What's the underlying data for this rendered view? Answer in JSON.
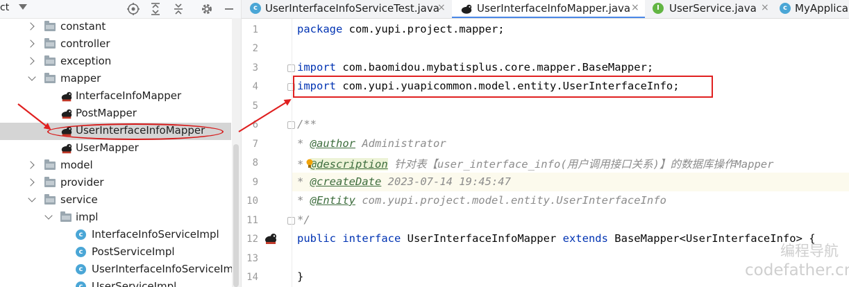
{
  "project_panel": {
    "title": "ct",
    "tree": [
      {
        "label": "constant",
        "kind": "folder",
        "expanded": false
      },
      {
        "label": "controller",
        "kind": "folder",
        "expanded": false
      },
      {
        "label": "exception",
        "kind": "folder",
        "expanded": false
      },
      {
        "label": "mapper",
        "kind": "folder",
        "expanded": true
      },
      {
        "label": "InterfaceInfoMapper",
        "kind": "mapper"
      },
      {
        "label": "PostMapper",
        "kind": "mapper"
      },
      {
        "label": "UserInterfaceInfoMapper",
        "kind": "mapper",
        "selected": true
      },
      {
        "label": "UserMapper",
        "kind": "mapper"
      },
      {
        "label": "model",
        "kind": "folder",
        "expanded": false
      },
      {
        "label": "provider",
        "kind": "folder",
        "expanded": false
      },
      {
        "label": "service",
        "kind": "folder",
        "expanded": true
      },
      {
        "label": "impl",
        "kind": "folder",
        "expanded": true
      },
      {
        "label": "InterfaceInfoServiceImpl",
        "kind": "class"
      },
      {
        "label": "PostServiceImpl",
        "kind": "class"
      },
      {
        "label": "UserInterfaceInfoServiceIm",
        "kind": "class"
      },
      {
        "label": "UserServiceImpl",
        "kind": "class"
      }
    ],
    "class_icon_letter": "c"
  },
  "tabs": [
    {
      "label": "UserInterfaceInfoServiceTest.java",
      "icon_letter": "c",
      "icon_color": "#4aa6d6",
      "active": false
    },
    {
      "label": "UserInterfaceInfoMapper.java",
      "icon_letter": "",
      "icon_color": "#1e1e1e",
      "active": true
    },
    {
      "label": "UserService.java",
      "icon_letter": "I",
      "icon_color": "#62b543",
      "active": false
    },
    {
      "label": "MyApplica",
      "icon_letter": "c",
      "icon_color": "#4aa6d6",
      "active": false
    }
  ],
  "tab_close_glyph": "×",
  "editor": {
    "line_numbers": [
      "1",
      "2",
      "3",
      "4",
      "5",
      "6",
      "7",
      "8",
      "9",
      "10",
      "11",
      "12",
      "13",
      "14"
    ],
    "lines": {
      "l1": {
        "kw": "package",
        "rest": " com.yupi.project.mapper;"
      },
      "l3": {
        "kw": "import",
        "rest": " com.baomidou.mybatisplus.core.mapper.BaseMapper;"
      },
      "l4": {
        "kw": "import",
        "rest": " com.yupi.yuapicommon.model.entity.UserInterfaceInfo;"
      },
      "l6": "/**",
      "l7": {
        "star": "* ",
        "tag": "@author",
        "rest": " Administrator"
      },
      "l8": {
        "star": "* ",
        "tag": "@description",
        "rest": " 针对表【user_interface_info(用户调用接口关系)】的数据库操作Mapper"
      },
      "l9": {
        "star": "* ",
        "tag": "@createDate",
        "rest": " 2023-07-14 19:45:47"
      },
      "l10": {
        "star": "* ",
        "tag": "@Entity",
        "rest": " com.yupi.project.model.entity.UserInterfaceInfo"
      },
      "l11": "*/",
      "l12": {
        "kw1": "public",
        "kw2": "interface",
        "name": " UserInterfaceInfoMapper ",
        "kw3": "extends",
        "rest": " BaseMapper<UserInterfaceInfo> {"
      },
      "l14": "}"
    }
  },
  "watermark": {
    "cn": "编程导航",
    "en": "codefather.cn"
  },
  "colors": {
    "keyword": "#0033b3",
    "annotation_red": "#e02020",
    "selection": "#d5d5d5",
    "accent_tab": "#4a88e8"
  }
}
